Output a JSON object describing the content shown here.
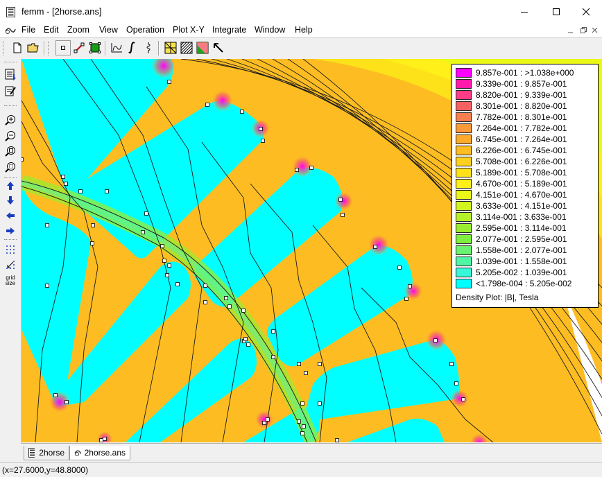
{
  "window": {
    "title": "femm - [2horse.ans]"
  },
  "menu": [
    "File",
    "Edit",
    "Zoom",
    "View",
    "Operation",
    "Plot X-Y",
    "Integrate",
    "Window",
    "Help"
  ],
  "legend": {
    "entries": [
      {
        "range": "9.857e-001 : >1.038e+000",
        "color": "#ff00ff"
      },
      {
        "range": "9.339e-001 : 9.857e-001",
        "color": "#ff1aaa"
      },
      {
        "range": "8.820e-001 : 9.339e-001",
        "color": "#fa3d86"
      },
      {
        "range": "8.301e-001 : 8.820e-001",
        "color": "#f56060"
      },
      {
        "range": "7.782e-001 : 8.301e-001",
        "color": "#f88050"
      },
      {
        "range": "7.264e-001 : 7.782e-001",
        "color": "#fc9a3a"
      },
      {
        "range": "6.745e-001 : 7.264e-001",
        "color": "#fdaa2a"
      },
      {
        "range": "6.226e-001 : 6.745e-001",
        "color": "#fdbd22"
      },
      {
        "range": "5.708e-001 : 6.226e-001",
        "color": "#fdd020"
      },
      {
        "range": "5.189e-001 : 5.708e-001",
        "color": "#fde21a"
      },
      {
        "range": "4.670e-001 : 5.189e-001",
        "color": "#fef018"
      },
      {
        "range": "4.151e-001 : 4.670e-001",
        "color": "#eaf818"
      },
      {
        "range": "3.633e-001 : 4.151e-001",
        "color": "#d2f520"
      },
      {
        "range": "3.114e-001 : 3.633e-001",
        "color": "#b5f02a"
      },
      {
        "range": "2.595e-001 : 3.114e-001",
        "color": "#99ec30"
      },
      {
        "range": "2.077e-001 : 2.595e-001",
        "color": "#80ee40"
      },
      {
        "range": "1.558e-001 : 2.077e-001",
        "color": "#6af270"
      },
      {
        "range": "1.039e-001 : 1.558e-001",
        "color": "#50f5a5"
      },
      {
        "range": "5.205e-002 : 1.039e-001",
        "color": "#36f8d8"
      },
      {
        "range": "<1.798e-004 : 5.205e-002",
        "color": "#00ffff"
      }
    ],
    "caption": "Density Plot: |B|, Tesla"
  },
  "left_toolbar": {
    "grid_size_label": "grid size"
  },
  "tabs": [
    "2horse",
    "2horse.ans"
  ],
  "status": "(x=27.6000,y=48.8000)"
}
